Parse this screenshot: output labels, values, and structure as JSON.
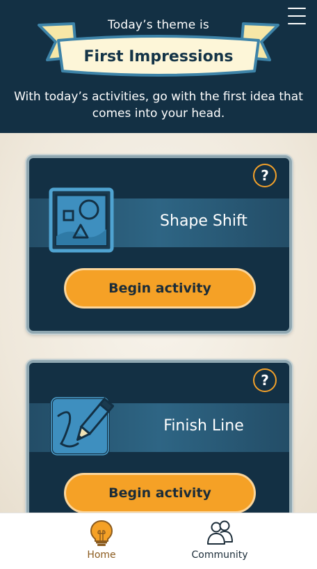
{
  "header": {
    "banner_top": "Today’s theme is",
    "banner_title": "First Impressions",
    "description": "With today’s activities, go with the first idea that comes into your head.",
    "menu_icon": "hamburger-menu-icon"
  },
  "cards": [
    {
      "title": "Shape Shift",
      "button_label": "Begin activity",
      "help_label": "?",
      "icon": "shapes-frame-icon"
    },
    {
      "title": "Finish Line",
      "button_label": "Begin activity",
      "help_label": "?",
      "icon": "pencil-drawing-icon"
    }
  ],
  "nav": {
    "home_label": "Home",
    "community_label": "Community",
    "active": "Home"
  },
  "colors": {
    "header_bg": "#133044",
    "accent_orange": "#f5a126",
    "card_band": "#2e6584",
    "banner_cream": "#fdf6d8"
  }
}
